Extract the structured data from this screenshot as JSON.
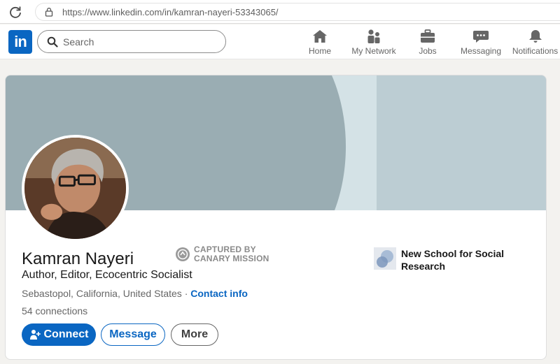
{
  "browser": {
    "url": "https://www.linkedin.com/in/kamran-nayeri-53343065/"
  },
  "nav": {
    "logo_text": "in",
    "search_placeholder": "Search",
    "items": [
      {
        "label": "Home",
        "icon": "home-icon"
      },
      {
        "label": "My Network",
        "icon": "my-network-icon"
      },
      {
        "label": "Jobs",
        "icon": "briefcase-icon"
      },
      {
        "label": "Messaging",
        "icon": "messaging-icon"
      },
      {
        "label": "Notifications",
        "icon": "bell-icon"
      }
    ]
  },
  "profile": {
    "name": "Kamran Nayeri",
    "headline": "Author, Editor, Ecocentric Socialist",
    "location": "Sebastopol, California, United States",
    "separator": " · ",
    "contact_info": "Contact info",
    "connections": "54 connections",
    "organization": "New School for Social Research"
  },
  "watermark": {
    "line1": "CAPTURED BY",
    "line2": "CANARY MISSION"
  },
  "actions": {
    "connect": "Connect",
    "message": "Message",
    "more": "More"
  },
  "colors": {
    "brand": "#0a66c2",
    "cover": "#9aadb3"
  }
}
